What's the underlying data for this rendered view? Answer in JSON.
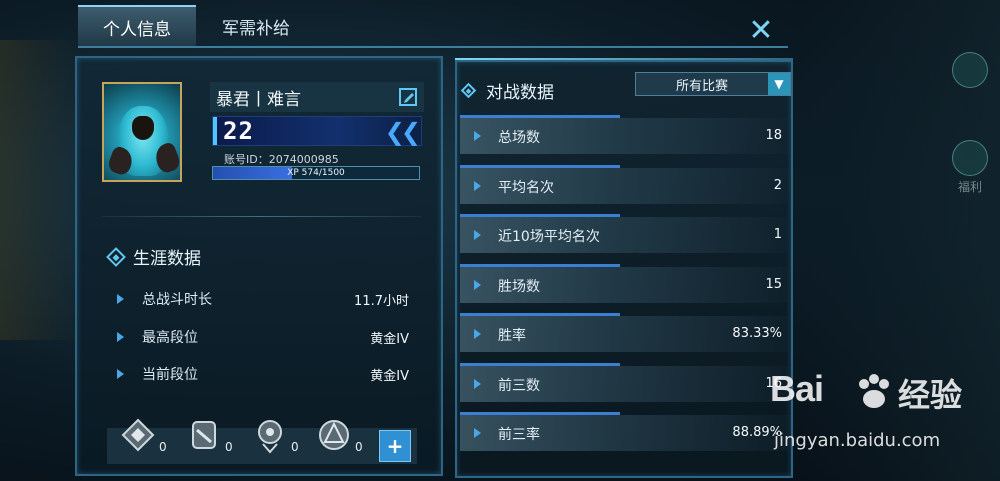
{
  "tabs": [
    {
      "label": "个人信息",
      "active": true
    },
    {
      "label": "军需补给",
      "active": false
    }
  ],
  "profile": {
    "name": "暴君丨难言",
    "level": "22",
    "account_id": "账号ID：2074000985",
    "xp_text": "XP 574/1500",
    "xp_current": 574,
    "xp_max": 1500
  },
  "career": {
    "title": "生涯数据",
    "rows": [
      {
        "label": "总战斗时长",
        "value": "11.7小时"
      },
      {
        "label": "最高段位",
        "value": "黄金IV"
      },
      {
        "label": "当前段位",
        "value": "黄金IV"
      }
    ]
  },
  "medals": [
    {
      "icon": "wings-medal-icon",
      "count": "0"
    },
    {
      "icon": "scroll-medal-icon",
      "count": "0"
    },
    {
      "icon": "wreath-medal-icon",
      "count": "0"
    },
    {
      "icon": "crosshair-medal-icon",
      "count": "0"
    }
  ],
  "battle": {
    "title": "对战数据",
    "filter": "所有比赛",
    "rows": [
      {
        "label": "总场数",
        "value": "18"
      },
      {
        "label": "平均名次",
        "value": "2"
      },
      {
        "label": "近10场平均名次",
        "value": "1"
      },
      {
        "label": "胜场数",
        "value": "15"
      },
      {
        "label": "胜率",
        "value": "83.33%"
      },
      {
        "label": "前三数",
        "value": "16"
      },
      {
        "label": "前三率",
        "value": "88.89%"
      }
    ]
  },
  "side": {
    "labels": [
      "福利",
      "福利"
    ]
  },
  "watermark": {
    "brand_left": "Bai",
    "brand_right": "经验",
    "url": "jingyan.baidu.com"
  },
  "colors": {
    "accent": "#5ec8f0",
    "panel_border": "#2e6584",
    "stat_line": "#3b7fd0",
    "xp_fill": "#234fb0",
    "plus_button": "#2f90d4"
  }
}
